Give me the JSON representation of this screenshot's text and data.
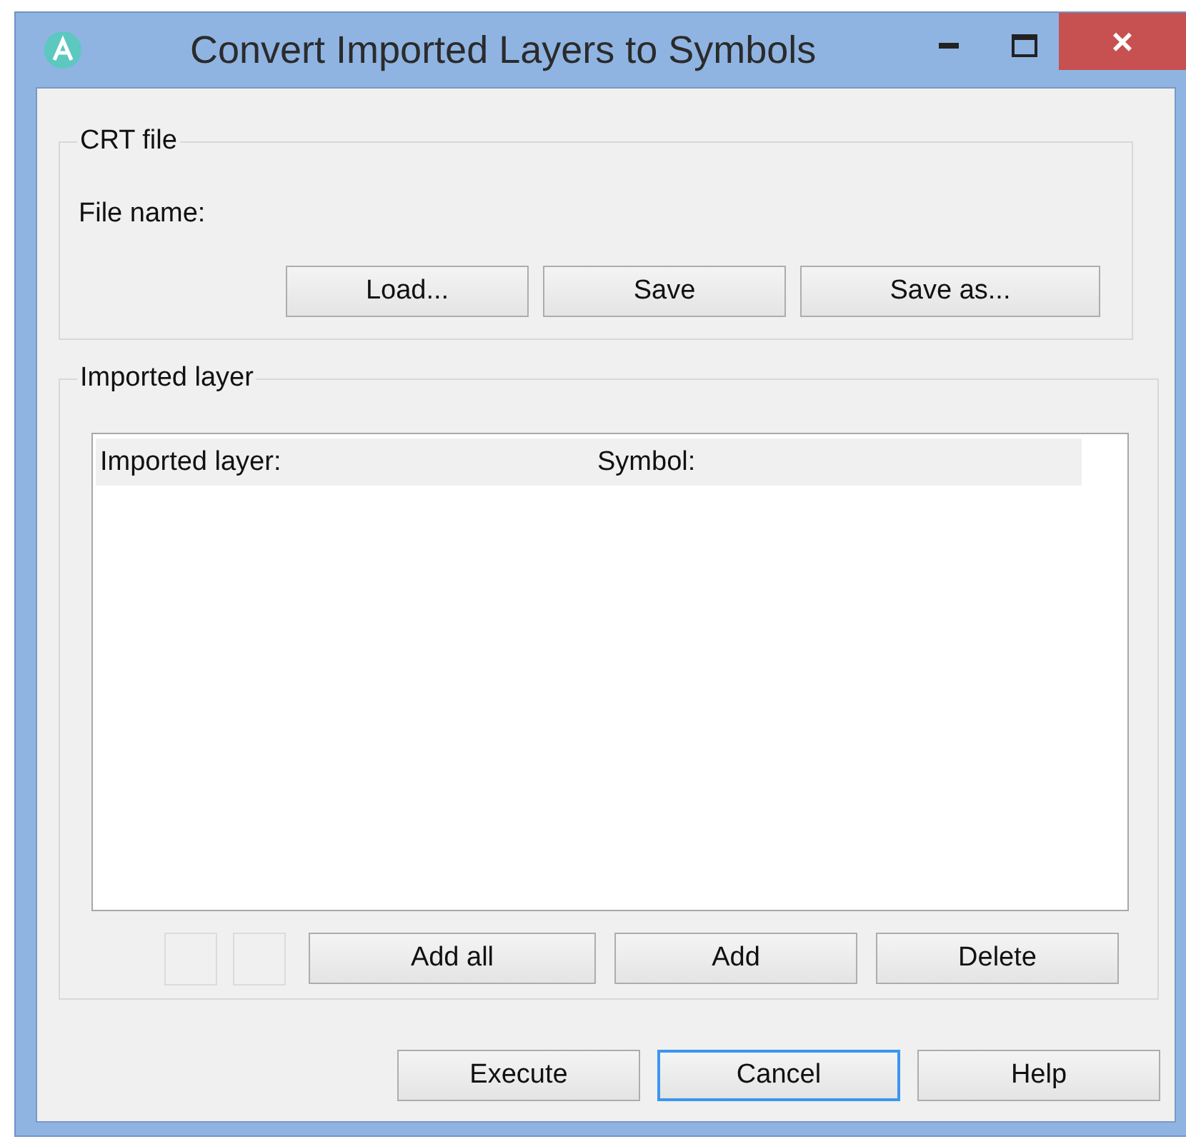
{
  "window": {
    "title": "Convert Imported Layers to Symbols",
    "controls": [
      {
        "kind": "minimize"
      },
      {
        "kind": "maximize"
      },
      {
        "kind": "close",
        "label": "×"
      }
    ]
  },
  "crt_file": {
    "title": "CRT file",
    "file_name_label": "File name:",
    "buttons": [
      {
        "label": "Load..."
      },
      {
        "label": "Save"
      },
      {
        "label": "Save as..."
      }
    ]
  },
  "imported_layer": {
    "title": "Imported layer",
    "list": {
      "columns": [
        "Imported layer:",
        "Symbol:"
      ]
    },
    "buttons": [
      {
        "label": "Add all"
      },
      {
        "label": "Add"
      },
      {
        "label": "Delete"
      }
    ]
  },
  "footer_buttons": [
    {
      "label": "Execute",
      "focused": false
    },
    {
      "label": "Cancel",
      "focused": true
    },
    {
      "label": "Help",
      "focused": false
    }
  ]
}
